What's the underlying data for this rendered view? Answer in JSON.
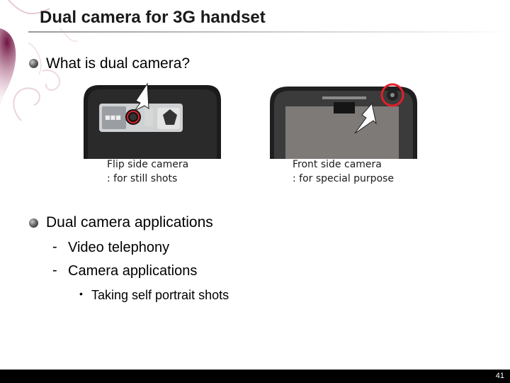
{
  "slide": {
    "title": "Dual camera for 3G handset",
    "bullet1": "What is dual camera?",
    "captions": {
      "flip_line1": "Flip side camera",
      "flip_line2": ": for still shots",
      "front_line1": "Front side camera",
      "front_line2": ": for special purpose"
    },
    "bullet2": "Dual camera applications",
    "sub_items": [
      "Video telephony",
      "Camera applications"
    ],
    "sub_sub_items": [
      "Taking self portrait shots"
    ],
    "page_number": "41"
  },
  "colors": {
    "highlight_circle": "#e0202a",
    "footer_bar": "#000000",
    "decoration_accent": "#9b2a5e"
  }
}
